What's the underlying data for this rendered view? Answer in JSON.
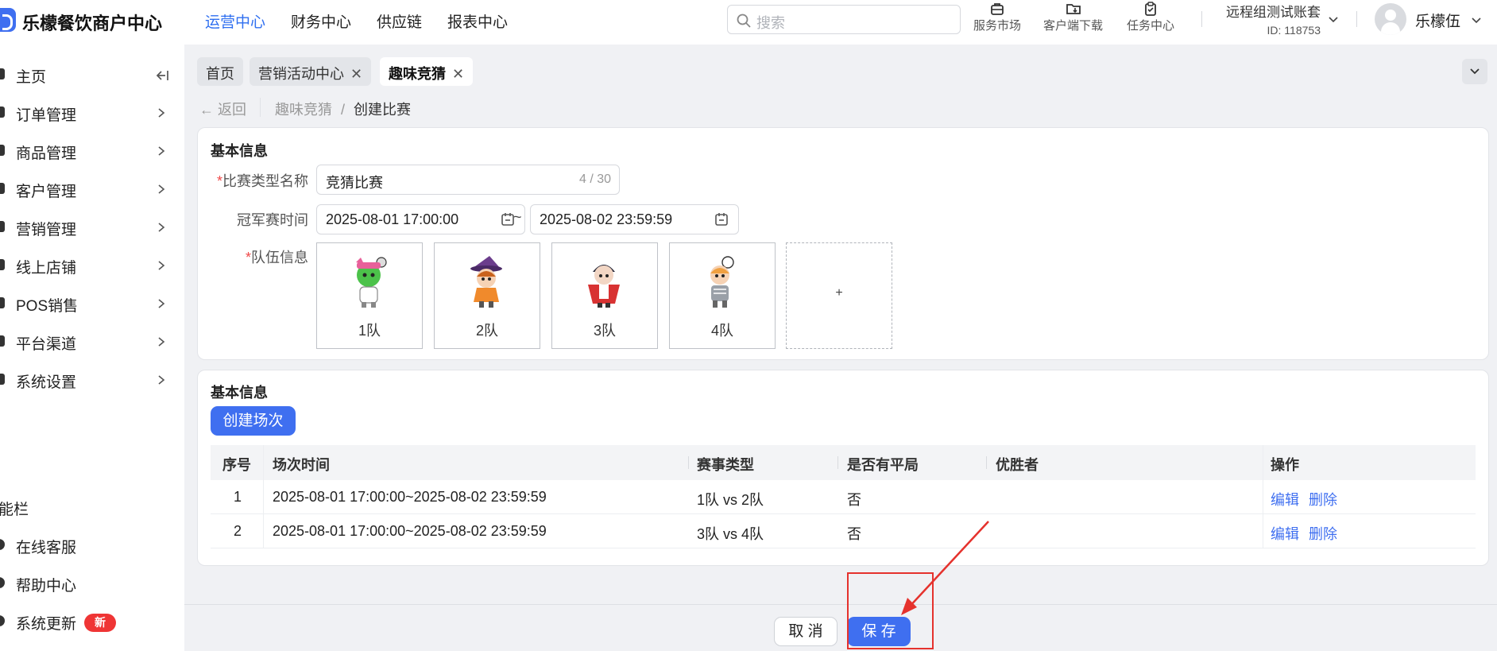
{
  "header": {
    "brand": "乐檬餐饮商户中心",
    "nav": [
      "运营中心",
      "财务中心",
      "供应链",
      "报表中心"
    ],
    "active_nav": "运营中心",
    "search_placeholder": "搜索",
    "tools": [
      {
        "label": "服务市场",
        "icon": "store-icon"
      },
      {
        "label": "客户端下载",
        "icon": "folder-download-icon"
      },
      {
        "label": "任务中心",
        "icon": "clipboard-icon"
      }
    ],
    "account_name": "远程组测试账套",
    "account_id": "ID: 118753",
    "user_name": "乐檬伍"
  },
  "sidebar": {
    "items": [
      {
        "label": "主页",
        "name": "sidebar-item-home"
      },
      {
        "label": "订单管理",
        "name": "sidebar-item-orders"
      },
      {
        "label": "商品管理",
        "name": "sidebar-item-products"
      },
      {
        "label": "客户管理",
        "name": "sidebar-item-customers"
      },
      {
        "label": "营销管理",
        "name": "sidebar-item-marketing"
      },
      {
        "label": "线上店铺",
        "name": "sidebar-item-online-store"
      },
      {
        "label": "POS销售",
        "name": "sidebar-item-pos"
      },
      {
        "label": "平台渠道",
        "name": "sidebar-item-channels"
      },
      {
        "label": "系统设置",
        "name": "sidebar-item-settings"
      }
    ],
    "section_title": "能栏",
    "bottom_items": [
      {
        "label": "在线客服",
        "name": "sidebar-item-support"
      },
      {
        "label": "帮助中心",
        "name": "sidebar-item-help"
      },
      {
        "label": "系统更新",
        "name": "sidebar-item-updates"
      }
    ],
    "update_badge": "新"
  },
  "tabs": [
    {
      "label": "首页",
      "closable": false,
      "active": false
    },
    {
      "label": "营销活动中心",
      "closable": true,
      "active": false
    },
    {
      "label": "趣味竞猜",
      "closable": true,
      "active": true
    }
  ],
  "tab_close_glyph": "✕",
  "breadcrumb": {
    "back": "返回",
    "parent": "趣味竞猜",
    "separator": "/",
    "current": "创建比赛"
  },
  "basic_info": {
    "title": "基本信息",
    "required_mark": "*",
    "name_label": "比赛类型名称",
    "name_value": "竞猜比赛",
    "name_count": "4 / 30",
    "time_label": "冠军赛时间",
    "start_time": "2025-08-01 17:00:00",
    "tilde": "~",
    "end_time": "2025-08-02 23:59:59",
    "teams_label": "队伍信息",
    "teams": [
      {
        "label": "1队",
        "color": "#4cc24a",
        "accent": "#e8609a"
      },
      {
        "label": "2队",
        "color": "#f08a2c",
        "accent": "#6b3d8c"
      },
      {
        "label": "3队",
        "color": "#d83232",
        "accent": "#2a2a3a"
      },
      {
        "label": "4队",
        "color": "#9aa0a8",
        "accent": "#f0a040"
      }
    ],
    "add_glyph": "+"
  },
  "sessions": {
    "title": "基本信息",
    "create_button": "创建场次",
    "columns": [
      "序号",
      "场次时间",
      "赛事类型",
      "是否有平局",
      "优胜者",
      "操作"
    ],
    "rows": [
      {
        "index": "1",
        "time": "2025-08-01 17:00:00~2025-08-02 23:59:59",
        "type": "1队 vs 2队",
        "draw": "否",
        "winner": "",
        "edit": "编辑",
        "delete": "删除"
      },
      {
        "index": "2",
        "time": "2025-08-01 17:00:00~2025-08-02 23:59:59",
        "type": "3队 vs 4队",
        "draw": "否",
        "winner": "",
        "edit": "编辑",
        "delete": "删除"
      }
    ]
  },
  "footer": {
    "cancel": "取 消",
    "save": "保 存"
  },
  "colors": {
    "primary": "#3f6ff0",
    "danger": "#e5322d",
    "required": "#f04848"
  }
}
